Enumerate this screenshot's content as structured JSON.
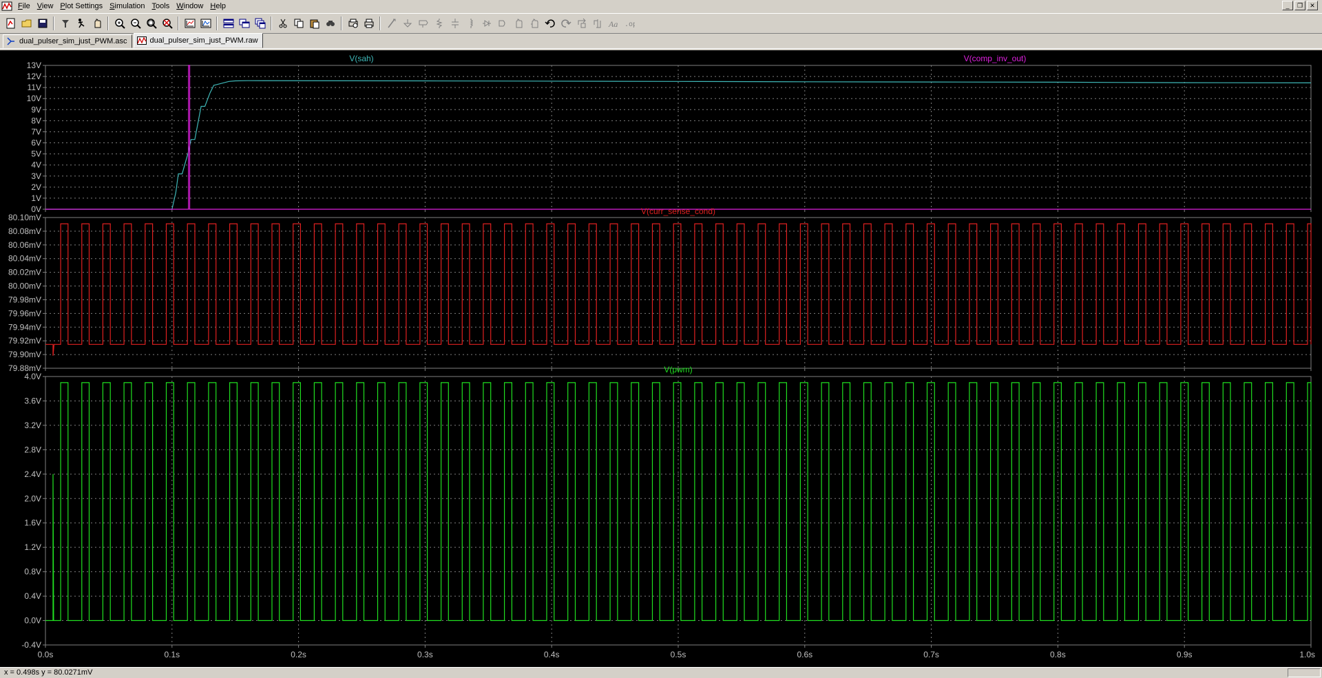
{
  "menu": {
    "items": [
      {
        "label": "File",
        "accel": "F",
        "rest": "ile"
      },
      {
        "label": "View",
        "accel": "V",
        "rest": "iew"
      },
      {
        "label": "Plot Settings",
        "accel": "P",
        "rest": "lot Settings"
      },
      {
        "label": "Simulation",
        "accel": "S",
        "rest": "imulation"
      },
      {
        "label": "Tools",
        "accel": "T",
        "rest": "ools"
      },
      {
        "label": "Window",
        "accel": "W",
        "rest": "indow"
      },
      {
        "label": "Help",
        "accel": "H",
        "rest": "elp"
      }
    ]
  },
  "toolbar": {
    "icons": [
      "new-schematic-icon",
      "open-icon",
      "save-icon",
      "control-panel-icon",
      "run-icon",
      "halt-icon",
      "zoom-in-icon",
      "zoom-out-icon",
      "zoom-fit-icon",
      "zoom-cancel-icon",
      "autorange-icon",
      "add-trace-icon",
      "tile-horizontal-icon",
      "tile-vertical-icon",
      "cascade-icon",
      "cut-icon",
      "copy-icon",
      "paste-icon",
      "find-icon",
      "print-preview-icon",
      "print-icon",
      "draw-wire-icon",
      "ground-icon",
      "label-net-icon",
      "resistor-icon",
      "capacitor-icon",
      "inductor-icon",
      "diode-icon",
      "component-icon",
      "move-icon",
      "drag-icon",
      "undo-icon",
      "redo-icon",
      "rotate-icon",
      "mirror-icon",
      "text-icon",
      "spice-directive-icon"
    ]
  },
  "tabs": [
    {
      "label": "dual_pulser_sim_just_PWM.asc",
      "icon": "schematic-icon",
      "active": false
    },
    {
      "label": "dual_pulser_sim_just_PWM.raw",
      "icon": "waveform-icon",
      "active": true
    }
  ],
  "colors": {
    "background": "#000000",
    "grid": "#808080",
    "axis_text": "#c0c0c0",
    "sah": "#3fb8b8",
    "comp_inv_out": "#e020e0",
    "curr_sense_cond": "#e02020",
    "pwm": "#20e020"
  },
  "chart_data": [
    {
      "type": "line",
      "title": "V(sah)",
      "series": [
        {
          "name": "V(sah)",
          "color": "#3fb8b8",
          "x": [
            0,
            0.1,
            0.103,
            0.105,
            0.108,
            0.11,
            0.113,
            0.115,
            0.118,
            0.12,
            0.123,
            0.126,
            0.13,
            0.133,
            0.135,
            0.14,
            0.145,
            0.15,
            0.16,
            0.3,
            0.5,
            0.6,
            0.7,
            0.8,
            0.85,
            0.9,
            1.0
          ],
          "y": [
            0,
            0,
            1.5,
            3.2,
            3.2,
            4.0,
            5.2,
            6.3,
            6.3,
            7.5,
            9.3,
            9.3,
            10.5,
            11.2,
            11.25,
            11.4,
            11.55,
            11.6,
            11.62,
            11.6,
            11.55,
            11.52,
            11.5,
            11.48,
            11.46,
            11.44,
            11.42
          ]
        },
        {
          "name": "V(comp_inv_out)",
          "color": "#e020e0",
          "x": [
            0,
            0.113,
            0.113,
            0.114,
            0.114,
            1.0
          ],
          "y": [
            0,
            0,
            13,
            13,
            0,
            0
          ]
        }
      ],
      "ylim": [
        0,
        13
      ],
      "yticks": [
        "13V",
        "12V",
        "11V",
        "10V",
        "9V",
        "8V",
        "7V",
        "6V",
        "5V",
        "4V",
        "3V",
        "2V",
        "1V",
        "0V"
      ]
    },
    {
      "type": "line",
      "title": "V(curr_sense_cond)",
      "series": [
        {
          "name": "V(curr_sense_cond)",
          "color": "#e02020",
          "low": 79.918,
          "high": 80.11,
          "period": 0.0167,
          "duty": 0.35
        }
      ],
      "ylim": [
        79.88,
        80.12
      ],
      "yticks": [
        "80.10mV",
        "80.08mV",
        "80.06mV",
        "80.04mV",
        "80.02mV",
        "80.00mV",
        "79.98mV",
        "79.96mV",
        "79.94mV",
        "79.92mV",
        "79.90mV",
        "79.88mV"
      ]
    },
    {
      "type": "line",
      "title": "V(pwm)",
      "series": [
        {
          "name": "V(pwm)",
          "color": "#20e020",
          "low": 0,
          "high": 3.9,
          "period": 0.0167,
          "duty": 0.35
        }
      ],
      "ylim": [
        -0.4,
        4.0
      ],
      "yticks": [
        "4.0V",
        "3.6V",
        "3.2V",
        "2.8V",
        "2.4V",
        "2.0V",
        "1.6V",
        "1.2V",
        "0.8V",
        "0.4V",
        "0.0V",
        "-0.4V"
      ]
    }
  ],
  "xaxis": {
    "ticks": [
      "0.0s",
      "0.1s",
      "0.2s",
      "0.3s",
      "0.4s",
      "0.5s",
      "0.6s",
      "0.7s",
      "0.8s",
      "0.9s",
      "1.0s"
    ],
    "xlim": [
      0,
      1.0
    ]
  },
  "status": {
    "text": "x = 0.498s   y = 80.0271mV"
  }
}
